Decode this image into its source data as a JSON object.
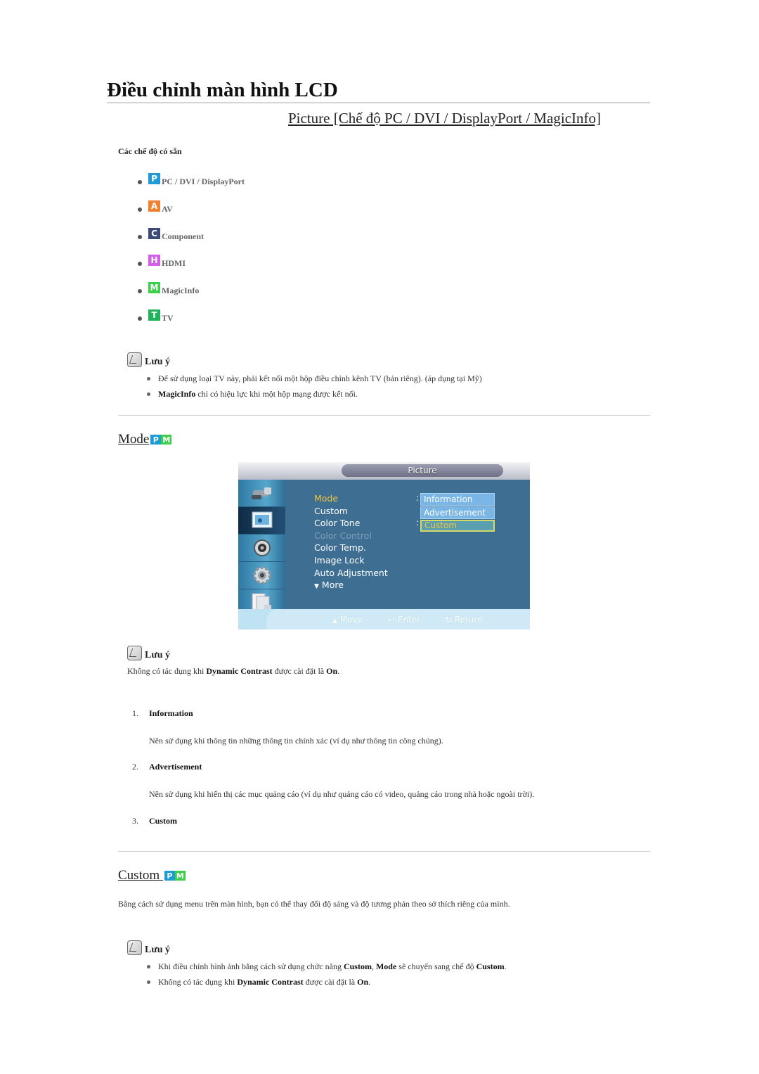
{
  "page": {
    "title": "Điều chỉnh màn hình LCD",
    "subtitle": "Picture [Chế độ PC / DVI / DisplayPort / MagicInfo]"
  },
  "available_modes": {
    "heading": "Các chế độ có sẵn",
    "items": [
      {
        "icon": "P",
        "label": "PC / DVI / DisplayPort",
        "color": "#1e9ad6"
      },
      {
        "icon": "A",
        "label": "AV",
        "color": "#f08030"
      },
      {
        "icon": "C",
        "label": "Component",
        "color": "#3c4a78"
      },
      {
        "icon": "H",
        "label": "HDMI",
        "color": "#d45ee8"
      },
      {
        "icon": "M",
        "label": "MagicInfo",
        "color": "#3ccf4a"
      },
      {
        "icon": "T",
        "label": "TV",
        "color": "#1fb35a"
      }
    ]
  },
  "note1": {
    "title": "Lưu ý",
    "items": [
      {
        "text": "Để sử dụng loại TV này, phải kết nối một hộp điều chỉnh kênh TV (bán riêng). (áp dụng tại Mỹ)"
      },
      {
        "bold": "MagicInfo",
        "text": " chỉ có hiệu lực khi một hộp mạng được kết nối."
      }
    ]
  },
  "mode_section": {
    "title": "Mode",
    "badges": [
      {
        "letter": "P",
        "color": "#1e9ad6"
      },
      {
        "letter": "M",
        "color": "#3ccf4a"
      }
    ],
    "osd": {
      "title": "Picture",
      "menu": [
        "Mode",
        "Custom",
        "Color Tone",
        "Color Control",
        "Color Temp.",
        "Image Lock",
        "Auto Adjustment",
        "More"
      ],
      "active_item": "Mode",
      "disabled_item": "Color Control",
      "dropdown": [
        "Information",
        "Advertisement",
        "Custom"
      ],
      "selected_option": "Custom",
      "hints": [
        "Move",
        "Enter",
        "Return"
      ]
    },
    "note": {
      "title": "Lưu ý",
      "text_pre": "Không có tác dụng khi ",
      "bold1": "Dynamic Contrast",
      "text_mid": " được cài đặt là ",
      "bold2": "On",
      "text_end": "."
    },
    "options": [
      {
        "num": "1.",
        "label": "Information",
        "desc": "Nên sử dụng khi thông tin những thông tin chính xác (ví dụ như thông tin công chúng)."
      },
      {
        "num": "2.",
        "label": "Advertisement",
        "desc": "Nên sử dụng khi hiển thị các mục quảng cáo (ví dụ như quảng cáo có video, quảng cáo trong nhà hoặc ngoài trời)."
      },
      {
        "num": "3.",
        "label": "Custom",
        "desc": ""
      }
    ]
  },
  "custom_section": {
    "title": "Custom",
    "description": "Bằng cách sử dụng menu trên màn hình, bạn có thể thay đổi độ sáng và độ tương phản theo sở thích riêng của mình.",
    "note": {
      "title": "Lưu ý",
      "item1": {
        "t1": "Khi điều chỉnh hình ảnh bằng cách sử dụng chức năng ",
        "b1": "Custom",
        "t2": ", ",
        "b2": "Mode",
        "t3": " sẽ chuyển sang chế độ ",
        "b3": "Custom",
        "t4": "."
      },
      "item2": {
        "t1": "Không có tác dụng khi ",
        "b1": "Dynamic Contrast",
        "t2": " được cài đặt là ",
        "b2": "On",
        "t3": "."
      }
    }
  }
}
